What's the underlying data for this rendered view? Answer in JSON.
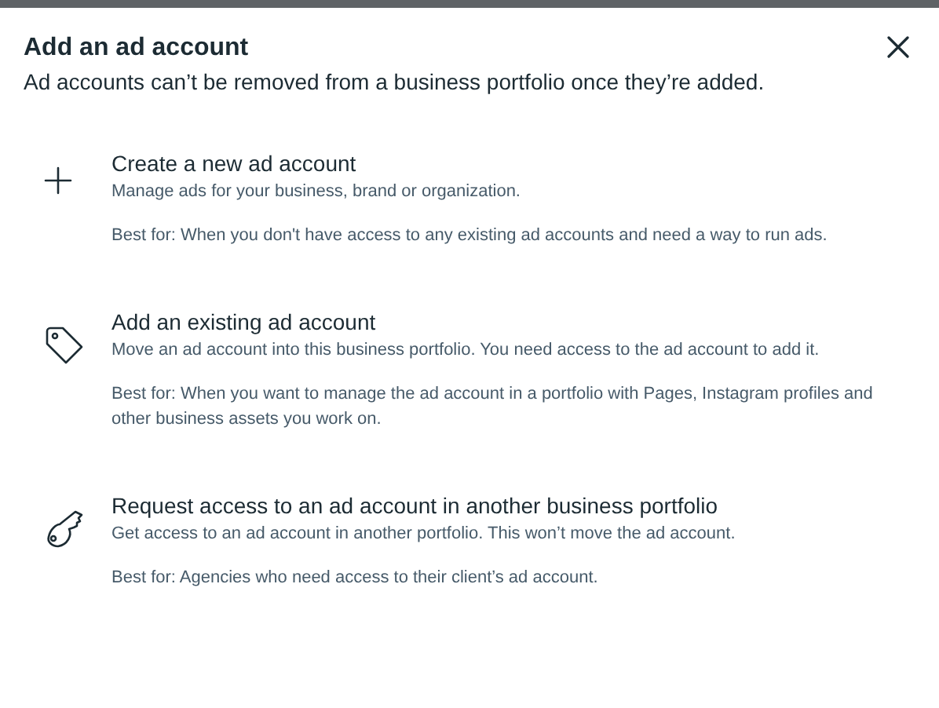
{
  "dialog": {
    "title": "Add an ad account",
    "subtitle": "Ad accounts can’t be removed from a business portfolio once they’re added."
  },
  "options": [
    {
      "kind": "plus",
      "title": "Create a new ad account",
      "description": "Manage ads for your business, brand or organization.",
      "best_for": "Best for: When you don't have access to any existing ad accounts and need a way to run ads."
    },
    {
      "kind": "tag",
      "title": "Add an existing ad account",
      "description": "Move an ad account into this business portfolio. You need access to the ad account to add it.",
      "best_for": "Best for: When you want to manage the ad account in a portfolio with Pages, Instagram profiles and other business assets you work on."
    },
    {
      "kind": "key",
      "title": "Request access to an ad account in another business portfolio",
      "description": "Get access to an ad account in another portfolio. This won’t move the ad account.",
      "best_for": "Best for: Agencies who need access to their client’s ad account."
    }
  ]
}
